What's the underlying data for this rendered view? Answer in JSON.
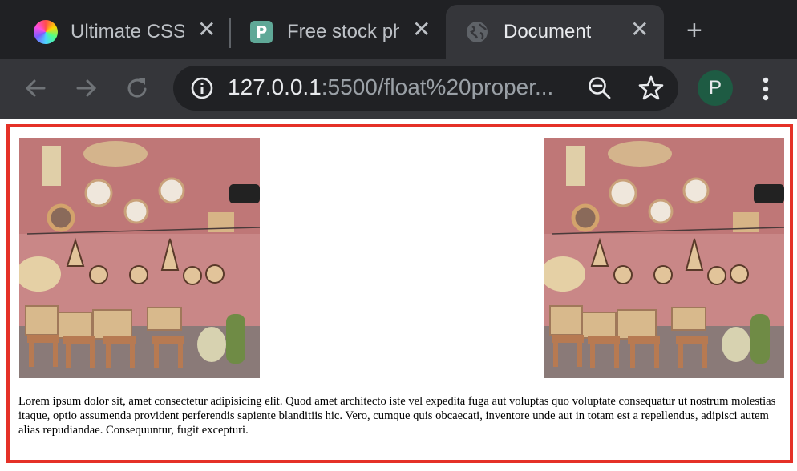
{
  "browser": {
    "tabs": [
      {
        "title": "Ultimate CSS",
        "favicon": "gradient-circle-icon",
        "active": false
      },
      {
        "title": "Free stock ph",
        "favicon": "pexels-p-icon",
        "active": false
      },
      {
        "title": "Document",
        "favicon": "globe-icon",
        "active": true
      }
    ],
    "close_glyph": "✕",
    "new_tab_glyph": "+",
    "url_host": "127.0.0.1",
    "url_rest": ":5500/float%20proper...",
    "profile_initial": "P",
    "colors": {
      "frame_border": "#e53127",
      "tab_bar": "#202124",
      "toolbar": "#35363a",
      "avatar": "#1e5b43"
    }
  },
  "page": {
    "paragraph": "Lorem ipsum dolor sit, amet consectetur adipisicing elit. Quod amet architecto iste vel expedita fuga aut voluptas quo voluptate consequatur ut nostrum molestias itaque, optio assumenda provident perferendis sapiente blanditiis hic. Vero, cumque quis obcaecati, inventore unde aut in totam est a repellendus, adipisci autem alias repudiandae. Consequuntur, fugit excepturi.",
    "images": [
      {
        "alt": "floated left image",
        "description_icon": "photo-icon"
      },
      {
        "alt": "floated right image",
        "description_icon": "photo-icon"
      }
    ]
  }
}
